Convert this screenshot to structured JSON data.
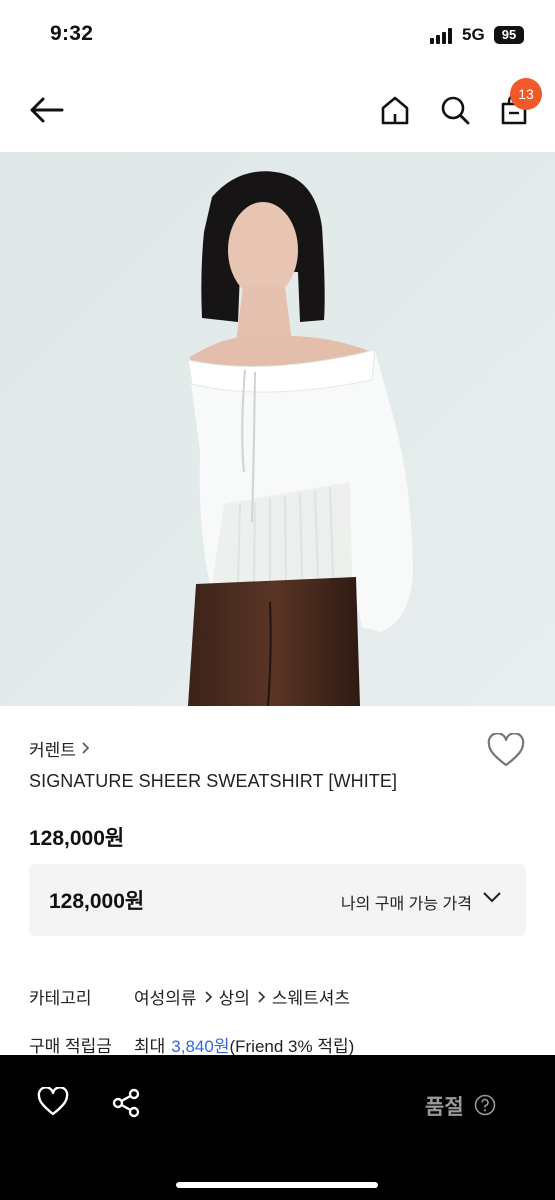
{
  "status_bar": {
    "time": "9:32",
    "network": "5G",
    "battery": "95"
  },
  "nav": {
    "cart_count": "13"
  },
  "product": {
    "brand": "커렌트",
    "name": "SIGNATURE SHEER SWEATSHIRT [WHITE]",
    "price": "128,000원",
    "my_price_value": "128,000원",
    "my_price_label": "나의 구매 가능 가격"
  },
  "info": {
    "category_label": "카테고리",
    "category_path": [
      "여성의류",
      "상의",
      "스웨트셔츠"
    ],
    "points_label": "구매 적립금",
    "points_prefix": "최대",
    "points_value": "3,840원",
    "points_suffix": "(Friend 3% 적립)"
  },
  "bottom_bar": {
    "status": "품절"
  },
  "colors": {
    "accent_badge": "#f05a28",
    "points_blue": "#2f6ad8",
    "sold_out_gray": "#9a9a9a"
  },
  "icons": [
    "back-arrow-icon",
    "home-icon",
    "search-icon",
    "cart-icon",
    "heart-icon",
    "share-icon",
    "help-icon",
    "chevron-right-icon",
    "chevron-down-icon"
  ]
}
